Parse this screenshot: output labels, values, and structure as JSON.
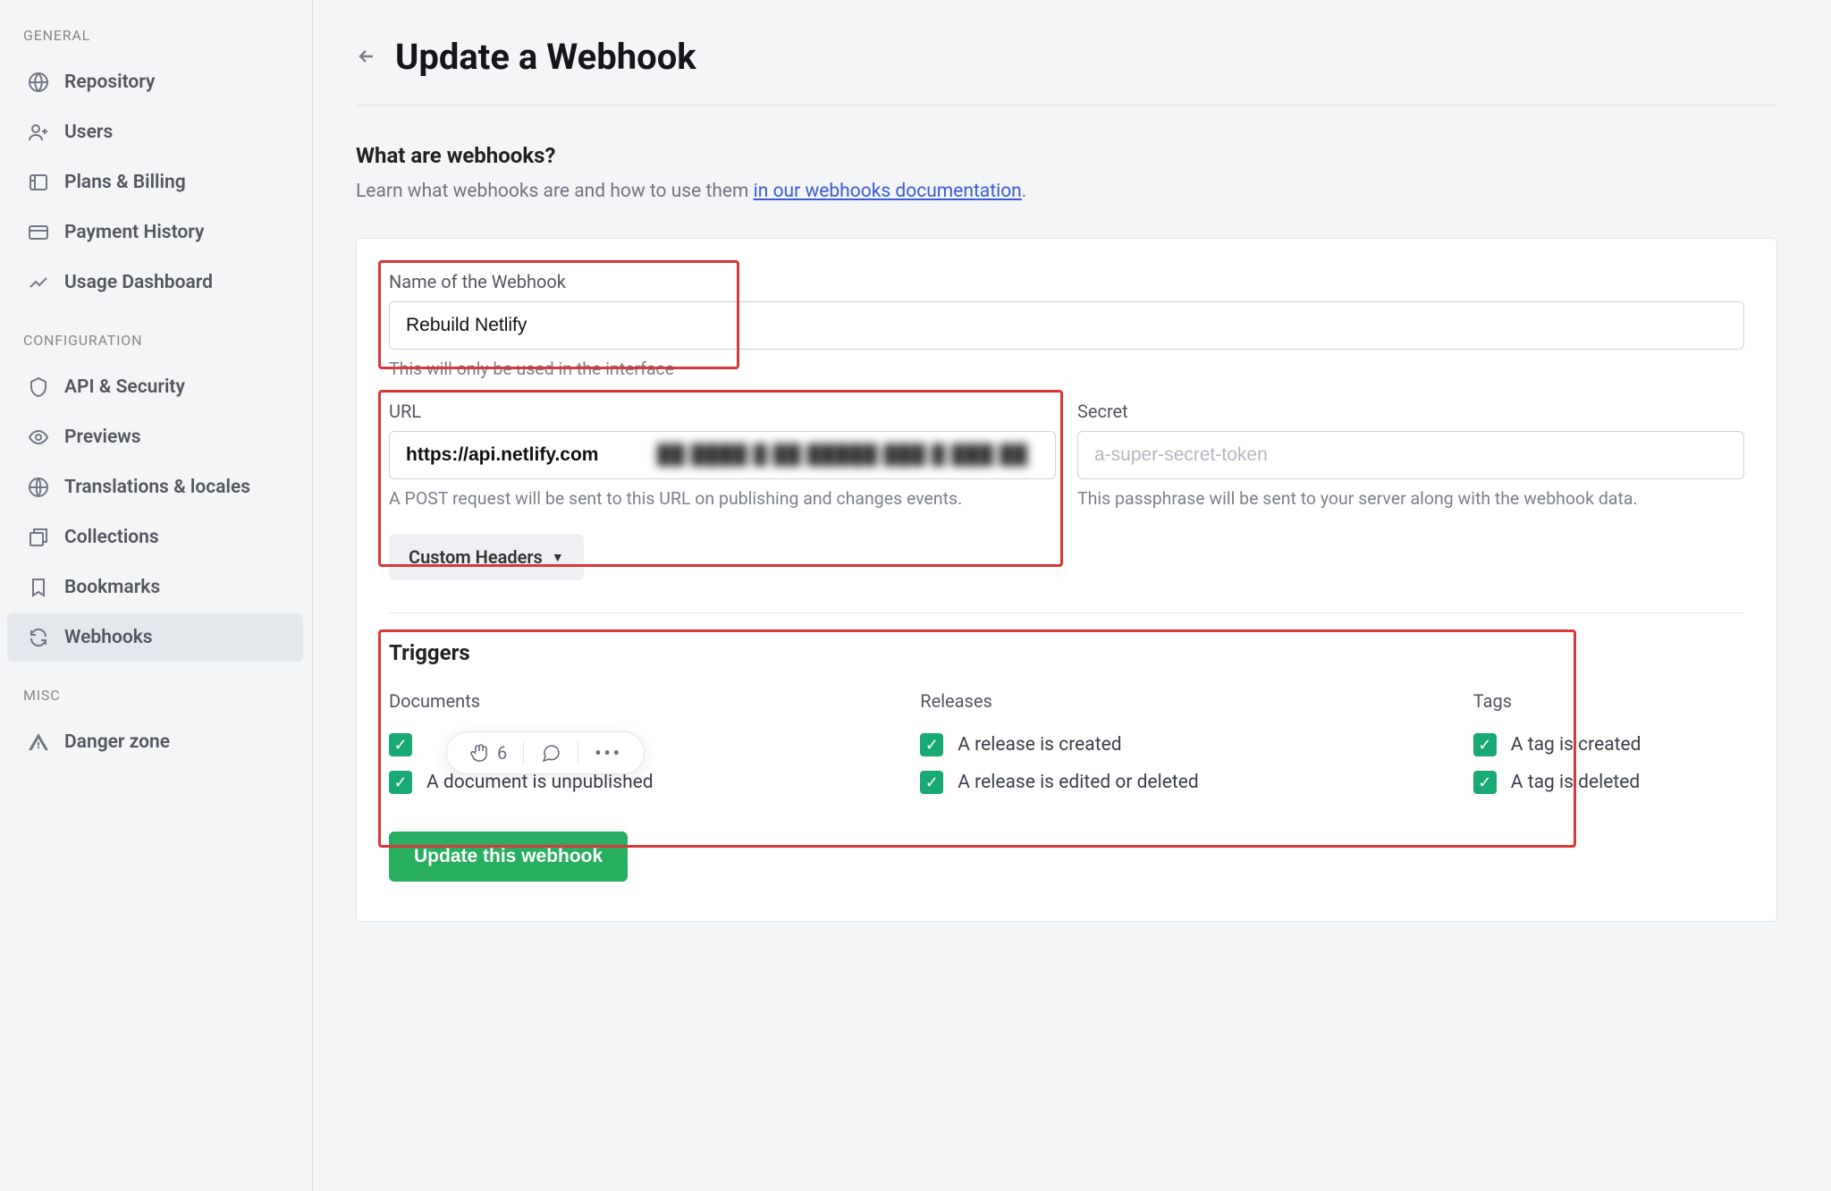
{
  "sidebar": {
    "sections": {
      "general": {
        "label": "GENERAL",
        "items": [
          {
            "label": "Repository",
            "icon": "globe"
          },
          {
            "label": "Users",
            "icon": "user-plus"
          },
          {
            "label": "Plans & Billing",
            "icon": "plans"
          },
          {
            "label": "Payment History",
            "icon": "card"
          },
          {
            "label": "Usage Dashboard",
            "icon": "chart"
          }
        ]
      },
      "configuration": {
        "label": "CONFIGURATION",
        "items": [
          {
            "label": "API & Security",
            "icon": "shield"
          },
          {
            "label": "Previews",
            "icon": "eye"
          },
          {
            "label": "Translations & locales",
            "icon": "globe2"
          },
          {
            "label": "Collections",
            "icon": "collections"
          },
          {
            "label": "Bookmarks",
            "icon": "bookmark"
          },
          {
            "label": "Webhooks",
            "icon": "refresh",
            "active": true
          }
        ]
      },
      "misc": {
        "label": "MISC",
        "items": [
          {
            "label": "Danger zone",
            "icon": "warning"
          }
        ]
      }
    }
  },
  "header": {
    "title": "Update a Webhook"
  },
  "intro": {
    "heading": "What are webhooks?",
    "text_before": "Learn what webhooks are and how to use them ",
    "link": "in our webhooks documentation",
    "text_after": "."
  },
  "form": {
    "name": {
      "label": "Name of the Webhook",
      "value": "Rebuild Netlify",
      "hint": "This will only be used in the interface"
    },
    "url": {
      "label": "URL",
      "value": "https://api.netlify.com",
      "hint": "A POST request will be sent to this URL on publishing and changes events."
    },
    "secret": {
      "label": "Secret",
      "placeholder": "a-super-secret-token",
      "hint": "This passphrase will be sent to your server along with the webhook data."
    },
    "custom_headers": "Custom Headers",
    "triggers": {
      "heading": "Triggers",
      "groups": [
        {
          "heading": "Documents",
          "items": [
            {
              "label": "",
              "checked": true
            },
            {
              "label": "A document is unpublished",
              "checked": true
            }
          ]
        },
        {
          "heading": "Releases",
          "items": [
            {
              "label": "A release is created",
              "checked": true
            },
            {
              "label": "A release is edited or deleted",
              "checked": true
            }
          ]
        },
        {
          "heading": "Tags",
          "items": [
            {
              "label": "A tag is created",
              "checked": true
            },
            {
              "label": "A tag is deleted",
              "checked": true
            }
          ]
        }
      ]
    },
    "submit": "Update this webhook"
  },
  "floatbar": {
    "claps": "6"
  }
}
